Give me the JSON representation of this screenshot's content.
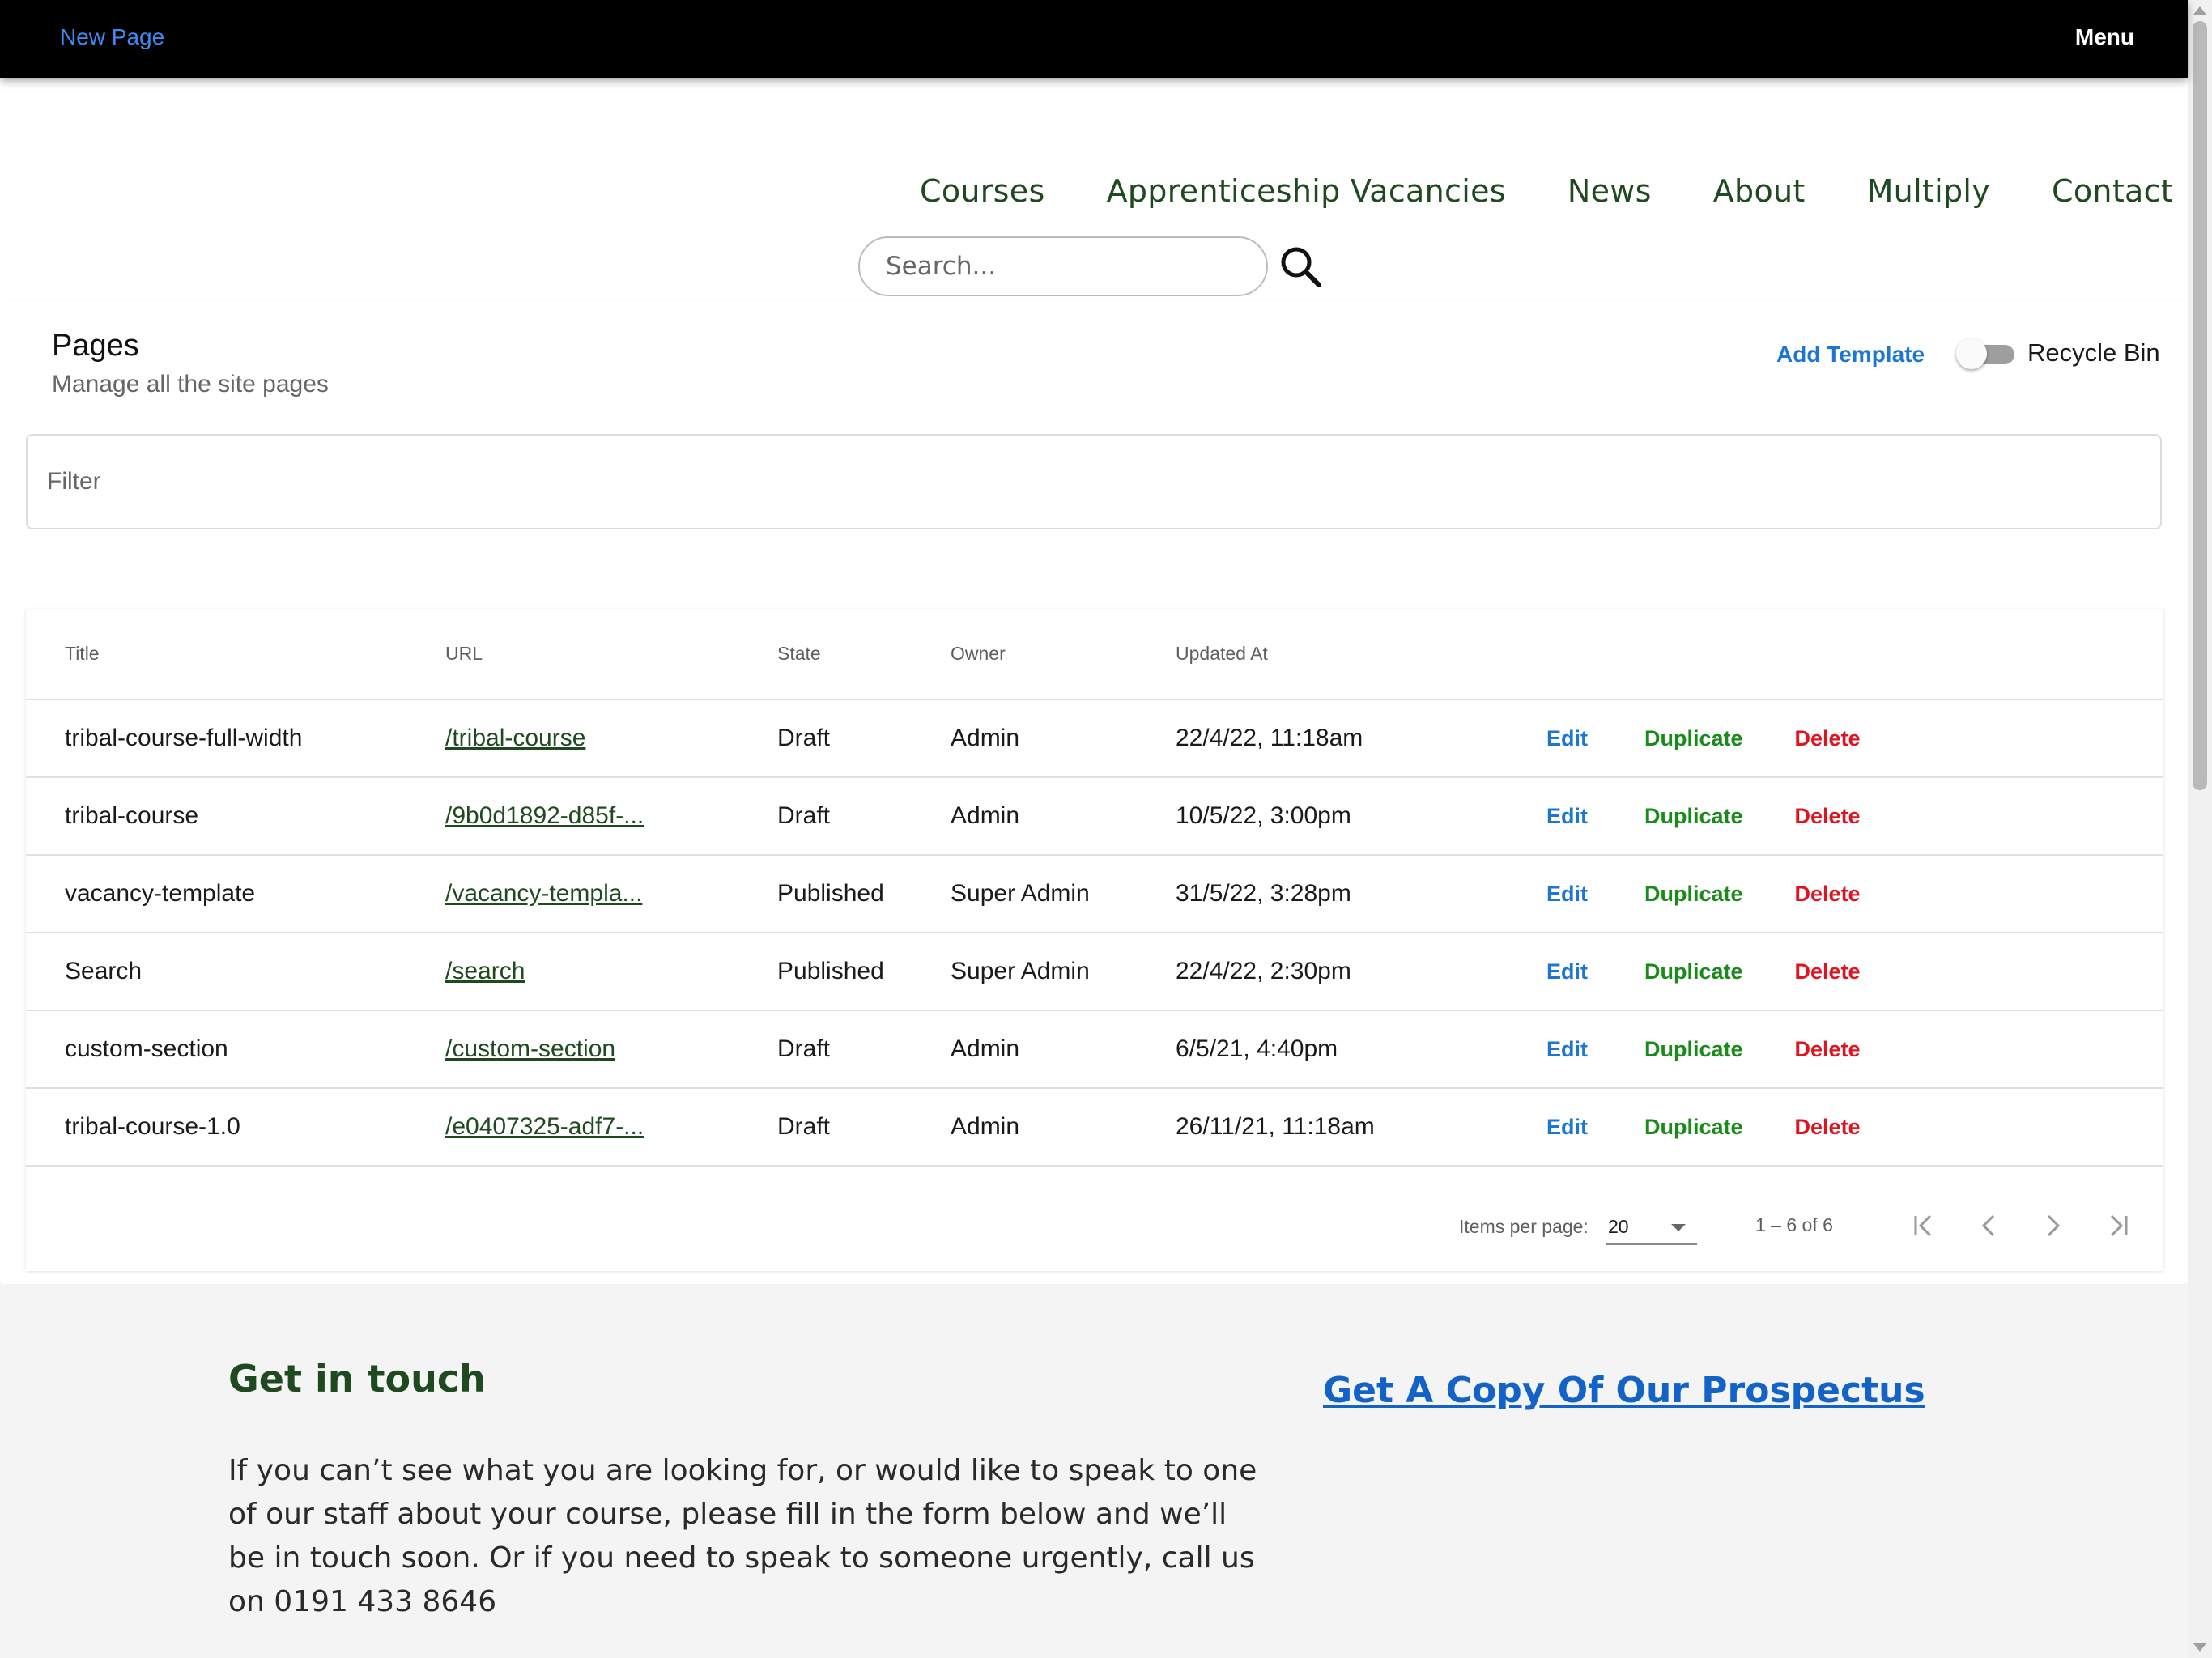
{
  "topbar": {
    "new_page": "New Page",
    "menu": "Menu"
  },
  "site_nav": [
    "Courses",
    "Apprenticeship Vacancies",
    "News",
    "About",
    "Multiply",
    "Contact"
  ],
  "search": {
    "placeholder": "Search..."
  },
  "panel": {
    "title": "Pages",
    "subtitle": "Manage all the site pages",
    "add_template": "Add Template",
    "recycle_bin": "Recycle Bin",
    "recycle_bin_on": false,
    "filter_placeholder": "Filter"
  },
  "table": {
    "columns": [
      "Title",
      "URL",
      "State",
      "Owner",
      "Updated At"
    ],
    "actions": {
      "edit": "Edit",
      "duplicate": "Duplicate",
      "delete": "Delete"
    },
    "rows": [
      {
        "title": "tribal-course-full-width",
        "url": "/tribal-course",
        "state": "Draft",
        "owner": "Admin",
        "updated": "22/4/22, 11:18am"
      },
      {
        "title": "tribal-course",
        "url": "/9b0d1892-d85f-...",
        "state": "Draft",
        "owner": "Admin",
        "updated": "10/5/22, 3:00pm"
      },
      {
        "title": "vacancy-template",
        "url": "/vacancy-templa...",
        "state": "Published",
        "owner": "Super Admin",
        "updated": "31/5/22, 3:28pm"
      },
      {
        "title": "Search",
        "url": "/search",
        "state": "Published",
        "owner": "Super Admin",
        "updated": "22/4/22, 2:30pm"
      },
      {
        "title": "custom-section",
        "url": "/custom-section",
        "state": "Draft",
        "owner": "Admin",
        "updated": "6/5/21, 4:40pm"
      },
      {
        "title": "tribal-course-1.0",
        "url": "/e0407325-adf7-...",
        "state": "Draft",
        "owner": "Admin",
        "updated": "26/11/21, 11:18am"
      }
    ]
  },
  "paginator": {
    "items_per_page_label": "Items per page:",
    "items_per_page": "20",
    "range": "1 – 6 of 6",
    "icons": [
      "first-page-icon",
      "previous-page-icon",
      "next-page-icon",
      "last-page-icon"
    ]
  },
  "footer": {
    "title": "Get in touch",
    "text": "If you can’t see what you are looking for, or would like to speak to one of our staff about your course, please fill in the form below and we’ll be in touch soon. Or if you need to speak to someone urgently, call us on 0191 433 8646",
    "prospectus": "Get A Copy Of Our Prospectus"
  },
  "colors": {
    "topbar_bg": "#000000",
    "nav_green": "#1f4a1f",
    "link_blue": "#1d76d4",
    "duplicate_green": "#1a8a1a",
    "delete_red": "#e0141e",
    "footer_bg": "#f4f4f4"
  }
}
